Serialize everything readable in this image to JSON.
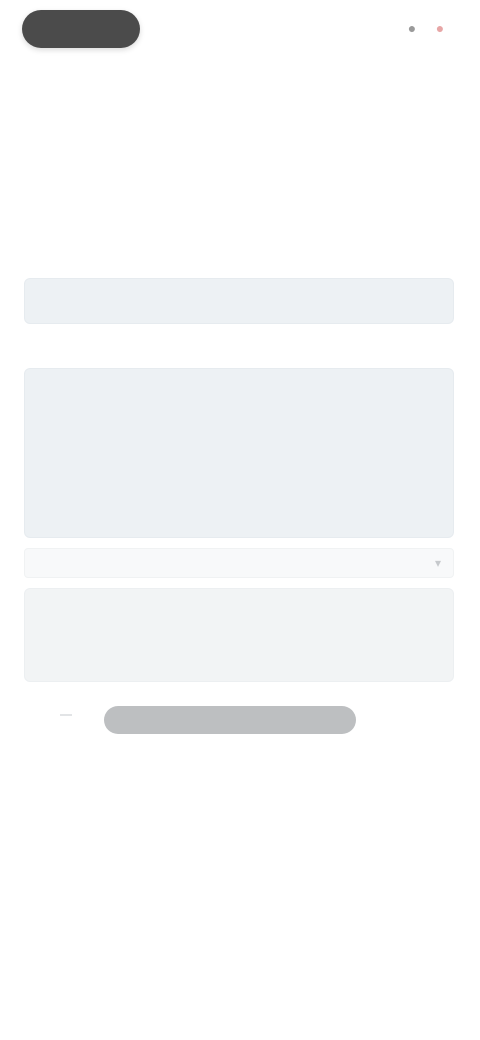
{
  "app": {
    "brand": "",
    "header_icons": [
      {
        "name": "profile-icon",
        "glyph": "●"
      },
      {
        "name": "notification-icon",
        "glyph": "●"
      }
    ]
  },
  "nav": {
    "links": [
      "",
      ""
    ],
    "meta": ""
  },
  "page": {
    "title": "",
    "subtitle": ""
  },
  "form": {
    "title_field": {
      "placeholder": "",
      "value": ""
    },
    "description_field": {
      "placeholder": "",
      "value": ""
    },
    "category_field": {
      "value": ""
    },
    "submit_label": "",
    "footer_note": ""
  },
  "colors": {
    "brand_pill": "#4b4b4b",
    "field_bg": "#edf1f4",
    "button": "#bdbfc1",
    "accent": "#e7a6a6"
  }
}
